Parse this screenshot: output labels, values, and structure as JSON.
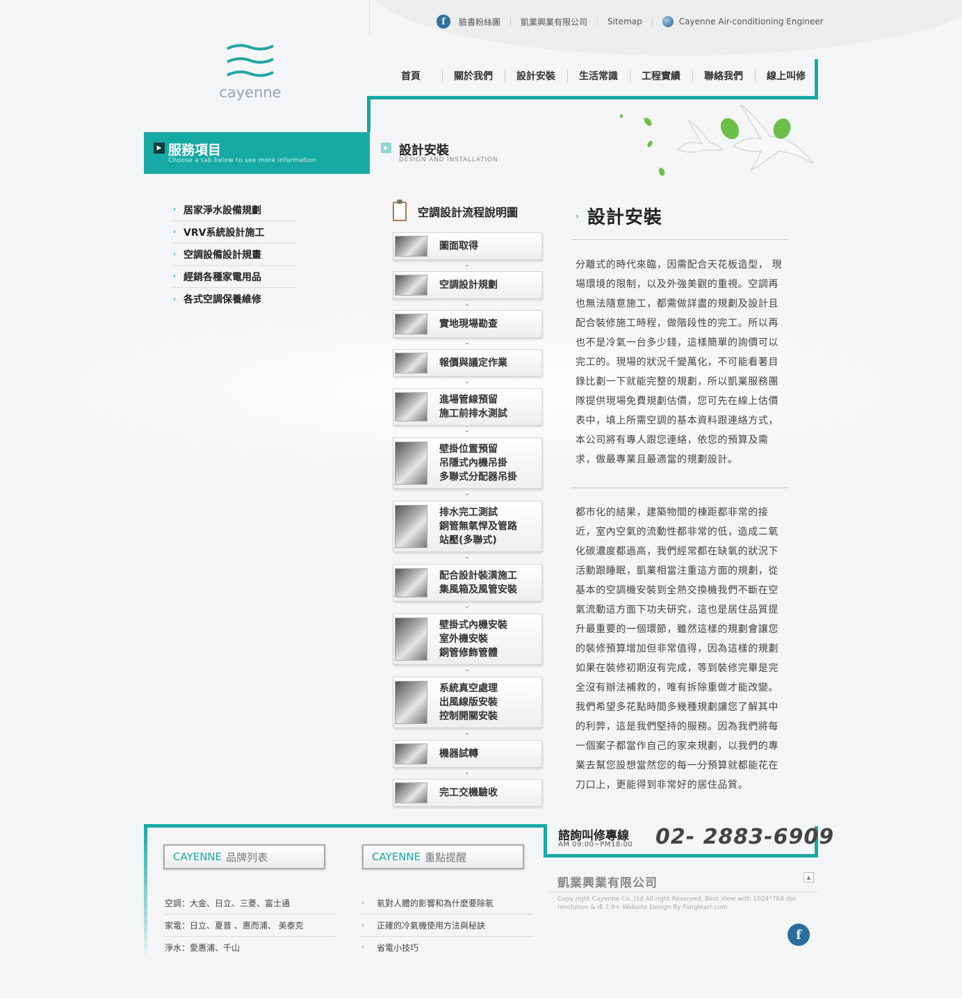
{
  "topbar": {
    "facebook": "臉書粉絲團",
    "company": "凱業興業有限公司",
    "sitemap": "Sitemap",
    "engineer": "Cayenne Air-conditioning Engineer"
  },
  "logo": {
    "text": "cayenne"
  },
  "nav": [
    {
      "label": "首頁"
    },
    {
      "label": "關於我們"
    },
    {
      "label": "設計安裝"
    },
    {
      "label": "生活常識"
    },
    {
      "label": "工程實績"
    },
    {
      "label": "聯絡我們"
    },
    {
      "label": "線上叫修"
    }
  ],
  "service": {
    "title": "服務項目",
    "subtitle": "Choose a tab below to see more information"
  },
  "section": {
    "title": "設計安裝",
    "subtitle": "DESIGN AND INSTALLATION"
  },
  "side_menu": [
    {
      "label": "居家淨水設備規劃"
    },
    {
      "label": "VRV系統設計施工"
    },
    {
      "label": "空調設備設計規畫"
    },
    {
      "label": "經銷各種家電用品"
    },
    {
      "label": "各式空調保養維修"
    }
  ],
  "flow": {
    "title": "空調設計流程說明圖",
    "steps": [
      {
        "lines": [
          "圖面取得"
        ]
      },
      {
        "lines": [
          "空調設計規劃"
        ]
      },
      {
        "lines": [
          "實地現場勘查"
        ]
      },
      {
        "lines": [
          "報價與議定作業"
        ]
      },
      {
        "lines": [
          "進場管線預留",
          "施工前排水測試"
        ]
      },
      {
        "lines": [
          "壁掛位置預留",
          "吊隱式內機吊掛",
          "多聯式分配器吊掛"
        ]
      },
      {
        "lines": [
          "排水完工測試",
          "銅管無氧悍及管路",
          "站壓(多聯式)"
        ]
      },
      {
        "lines": [
          "配合設計裝潢施工",
          "集風箱及風管安裝"
        ]
      },
      {
        "lines": [
          "壁掛式內機安裝",
          "室外機安裝",
          "銅管修飾管體"
        ]
      },
      {
        "lines": [
          "系統真空處理",
          "出風線版安裝",
          "控制開關安裝"
        ]
      },
      {
        "lines": [
          "機器試轉"
        ]
      },
      {
        "lines": [
          "完工交機驗收"
        ]
      }
    ]
  },
  "article": {
    "title": "設計安裝",
    "para1": [
      "分離式的時代來臨，因需配合天花板造型， 現",
      "場環境的限制，以及外強美觀的重視。空調再",
      "也無法隨意施工，都需做詳盡的規劃及設計且",
      "配合裝修施工時程，做階段性的完工。所以再",
      "也不是冷氣一台多少錢，這樣簡單的詢價可以",
      "完工的。現場的狀況千變萬化，不可能看著目",
      "錄比劃一下就能完整的規劃，所以凱業服務團",
      "隊提供現場免費規劃估價，您可先在線上估價",
      "表中，填上所需空調的基本資料跟連絡方式，",
      "本公司將有專人跟您連絡，依您的預算及需",
      "求，做最專業且最適當的規劃設計。"
    ],
    "para2": [
      "都市化的結果，建築物間的棟距都非常的接",
      "近，室內空氣的流動性都非常的低，造成二氧",
      "化碳濃度都過高，我們經常都在缺氧的狀況下",
      "活動跟睡眠，凱業相當注重這方面的規劃，從",
      "基本的空調機安裝到全熱交換機我們不斷在空",
      "氣流動這方面下功夫研究，這也是居住品質提",
      "升最重要的一個環節，雖然這樣的規劃會讓您",
      "的裝修預算增加但非常值得，因為這樣的規劃",
      "如果在裝修初期沒有完成，等到裝修完畢是完",
      "全沒有辦法補救的，唯有拆除重做才能改變。",
      "我們希望多花點時間多幾種規劃讓您了解其中",
      "的利弊，這是我們堅持的服務。因為我們將每",
      "一個案子都當作自己的家來規劃，以我們的專",
      "業去幫您設想當然您的每一分預算就都能花在",
      "刀口上，更能得到非常好的居住品質。"
    ]
  },
  "footer": {
    "brand_box": {
      "en": "CAYENNE",
      "zh": "品牌列表"
    },
    "tip_box": {
      "en": "CAYENNE",
      "zh": "重點提醒"
    },
    "brands": [
      "空調：大金、日立、三菱、富士通",
      "家電：日立、夏普 、惠而浦、 美泰克",
      "淨水：愛惠浦、千山"
    ],
    "tips": [
      "氡對人體的影響和為什麼要除氡",
      "正確的冷氣機使用方法與秘訣",
      "省電小技巧"
    ],
    "hotline_label": "諮詢叫修專線",
    "hotline_hours": "AM 09:00~PM18:00",
    "hotline_number": "02- 2883-6909",
    "company": "凱業興業有限公司",
    "copyright": "Copy right Cayenne Co.,Ltd All right Reserved. Best View with 1024*768 dpi resolution & IE 7.0+ Website Design By Fangleart.com"
  },
  "colors": {
    "accent": "#17aaa5",
    "facebook": "#2f6f9e"
  },
  "icons": [
    "facebook-icon",
    "globe-icon",
    "clipboard-icon",
    "chevron-right-icon",
    "chevron-down-icon",
    "back-to-top-icon"
  ]
}
